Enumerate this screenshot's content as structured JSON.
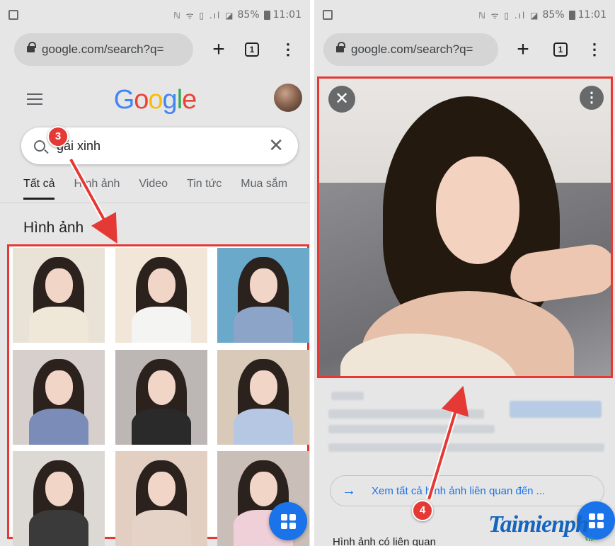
{
  "status_bar": {
    "icons": "ℕ ᯤ ▯ .ıl ◪",
    "battery": "85%",
    "time": "11:01"
  },
  "browser": {
    "url": "google.com/search?q=",
    "plus": "+",
    "tab_count": "1",
    "menu": "⋮"
  },
  "google": {
    "logo": [
      "G",
      "o",
      "o",
      "g",
      "l",
      "e"
    ],
    "search_value": "gái xinh",
    "clear": "✕",
    "tabs": [
      "Tất cả",
      "Hình ảnh",
      "Video",
      "Tin tức",
      "Mua sắm"
    ],
    "section_title": "Hình ảnh"
  },
  "images": {
    "colors": [
      "#e9e2d6",
      "#f1e6d8",
      "#6aa9c9",
      "#d6cfcc",
      "#bcb6b4",
      "#d9c9b9",
      "#dcd8d3",
      "#e2cfc2",
      "#c9bfb8"
    ],
    "clothes": [
      "#efe8d8",
      "#f4f4f2",
      "#8ba4c8",
      "#7b8cb8",
      "#2a2a2a",
      "#b6c7e4",
      "#3a3a3a",
      "#e6d3c8",
      "#f0d0d8"
    ]
  },
  "steps": {
    "step3": "3",
    "step4": "4"
  },
  "viewer": {
    "close": "✕",
    "menu": "⋮"
  },
  "related": {
    "see_all": "Xem tất cả hình ảnh liên quan đến ...",
    "arrow": "→",
    "heading": "Hình ảnh có liên quan"
  },
  "watermark": {
    "brand": "Taimienph",
    "sub": "vn"
  }
}
